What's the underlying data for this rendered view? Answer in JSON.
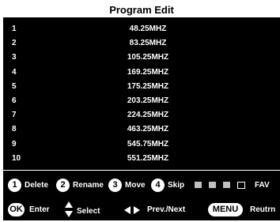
{
  "title": "Program Edit",
  "programs": [
    {
      "num": "1",
      "freq": "48.25MHZ"
    },
    {
      "num": "2",
      "freq": "83.25MHZ"
    },
    {
      "num": "3",
      "freq": "105.25MHZ"
    },
    {
      "num": "4",
      "freq": "169.25MHZ"
    },
    {
      "num": "5",
      "freq": "175.25MHZ"
    },
    {
      "num": "6",
      "freq": "203.25MHZ"
    },
    {
      "num": "7",
      "freq": "224.25MHZ"
    },
    {
      "num": "8",
      "freq": "463.25MHZ"
    },
    {
      "num": "9",
      "freq": "545.75MHZ"
    },
    {
      "num": "10",
      "freq": "551.25MHZ"
    }
  ],
  "legend": {
    "delete_num": "1",
    "delete_label": "Delete",
    "rename_num": "2",
    "rename_label": "Rename",
    "move_num": "3",
    "move_label": "Move",
    "skip_num": "4",
    "skip_label": "Skip",
    "fav_label": "FAV"
  },
  "controls": {
    "ok_label": "OK",
    "enter_label": "Enter",
    "select_label": "Select",
    "prev_next_label": "Prev./Next",
    "menu_label": "MENU",
    "return_label": "Reutrn"
  },
  "colors": {
    "background": "#000000",
    "title_bar": "#ffffff",
    "swatch": "#c0c0c0"
  }
}
